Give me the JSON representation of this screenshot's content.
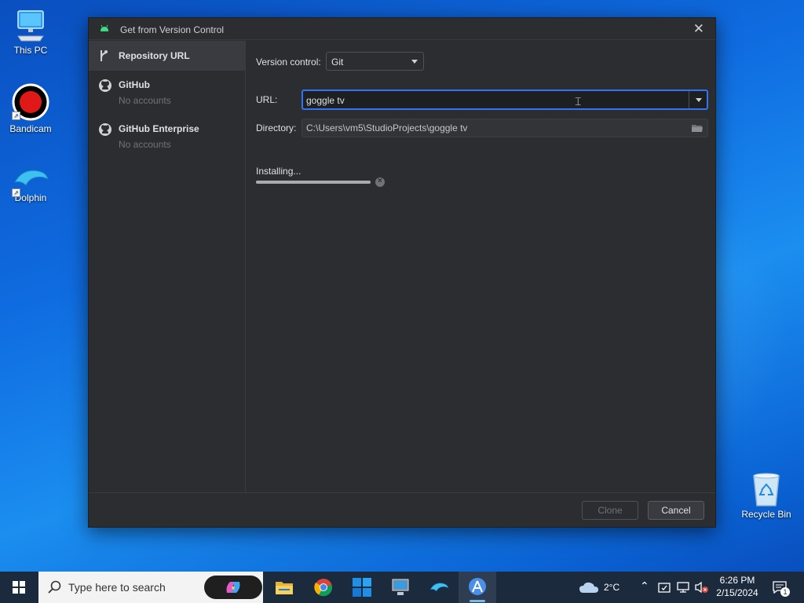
{
  "desktop": {
    "icons": [
      {
        "label": "This PC"
      },
      {
        "label": "Bandicam"
      },
      {
        "label": "Dolphin"
      }
    ],
    "recycle_bin_label": "Recycle Bin"
  },
  "dialog": {
    "title": "Get from Version Control",
    "sidebar": {
      "items": [
        {
          "label": "Repository URL",
          "sub": ""
        },
        {
          "label": "GitHub",
          "sub": "No accounts"
        },
        {
          "label": "GitHub Enterprise",
          "sub": "No accounts"
        }
      ]
    },
    "form": {
      "version_control_label": "Version control:",
      "version_control_value": "Git",
      "url_label": "URL:",
      "url_value": "goggle tv",
      "directory_label": "Directory:",
      "directory_value": "C:\\Users\\vm5\\StudioProjects\\goggle tv",
      "status_text": "Installing...",
      "progress_fraction": 1.0
    },
    "buttons": {
      "clone": "Clone",
      "cancel": "Cancel"
    }
  },
  "taskbar": {
    "search_placeholder": "Type here to search",
    "weather": "2°C",
    "time": "6:26 PM",
    "date": "2/15/2024",
    "notification_count": "1"
  },
  "colors": {
    "dialog_bg": "#2b2d30",
    "accent": "#3574f0",
    "taskbar_bg": "#1c2a3e"
  }
}
